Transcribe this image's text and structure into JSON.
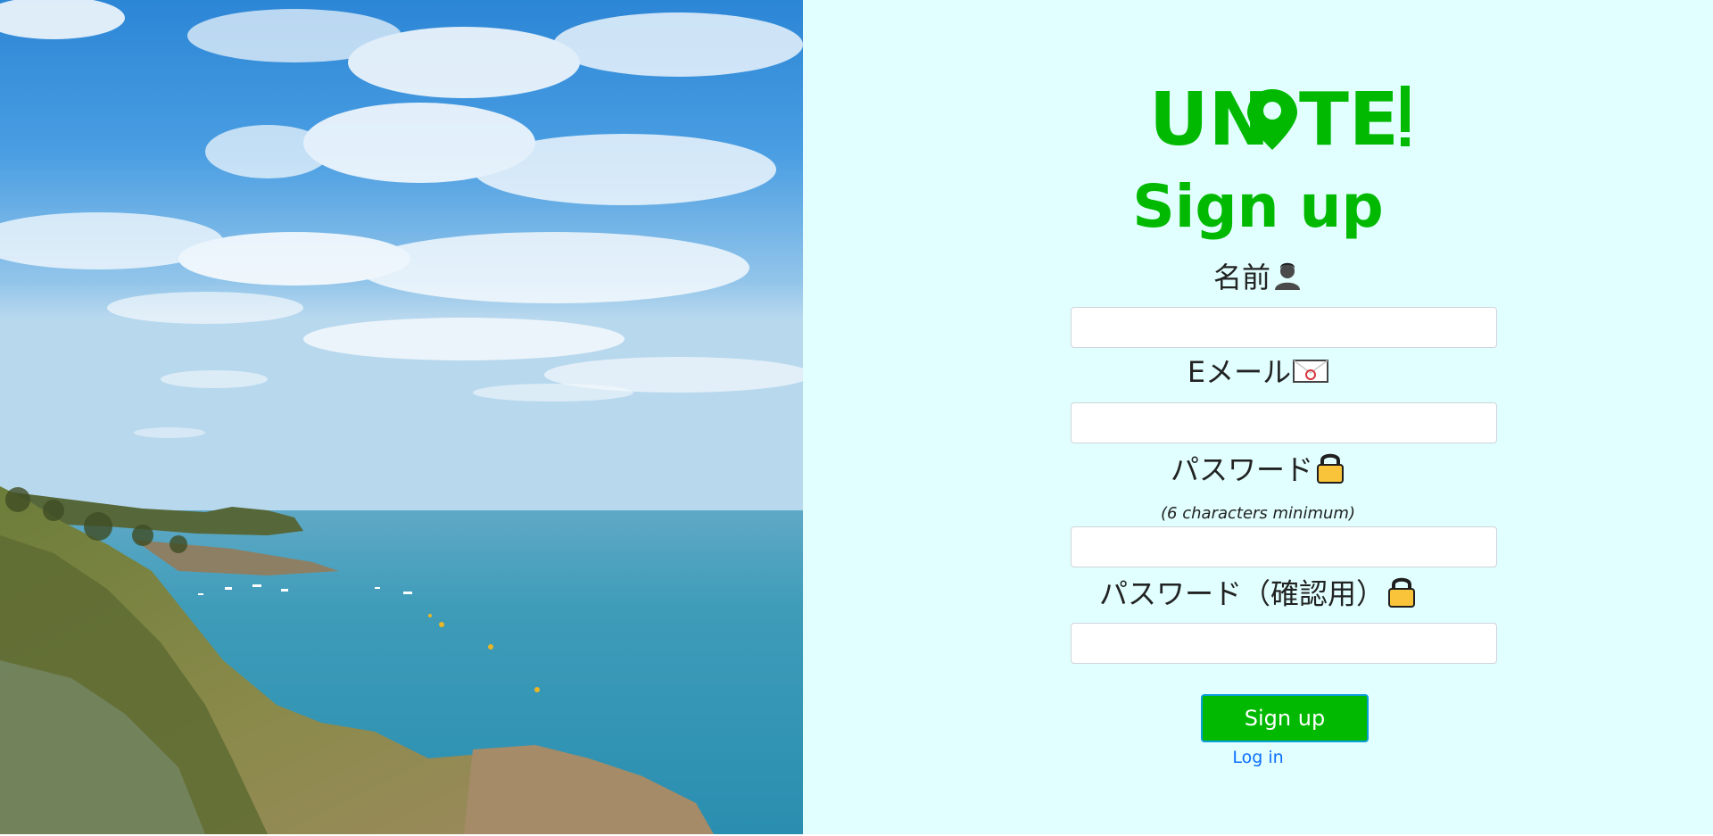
{
  "hero": {
    "image": "coastal-landscape-photo"
  },
  "form": {
    "logo_text": "UN TE!",
    "title": "Sign up",
    "name_label": "名前",
    "name_icon": "person-emoji-icon",
    "email_label": "Eメール",
    "email_icon": "envelope-emoji-icon",
    "password_label": "パスワード",
    "password_icon": "lock-emoji-icon",
    "password_hint": "(6 characters minimum)",
    "password_confirm_label": "パスワード（確認用）",
    "password_confirm_icon": "lock-emoji-icon",
    "name_value": "",
    "email_value": "",
    "password_value": "",
    "password_confirm_value": "",
    "submit_label": "Sign up",
    "login_link": "Log in"
  },
  "colors": {
    "brand_green": "#00b900",
    "panel_bg": "#e0fffe",
    "link_blue": "#0d6efd"
  }
}
